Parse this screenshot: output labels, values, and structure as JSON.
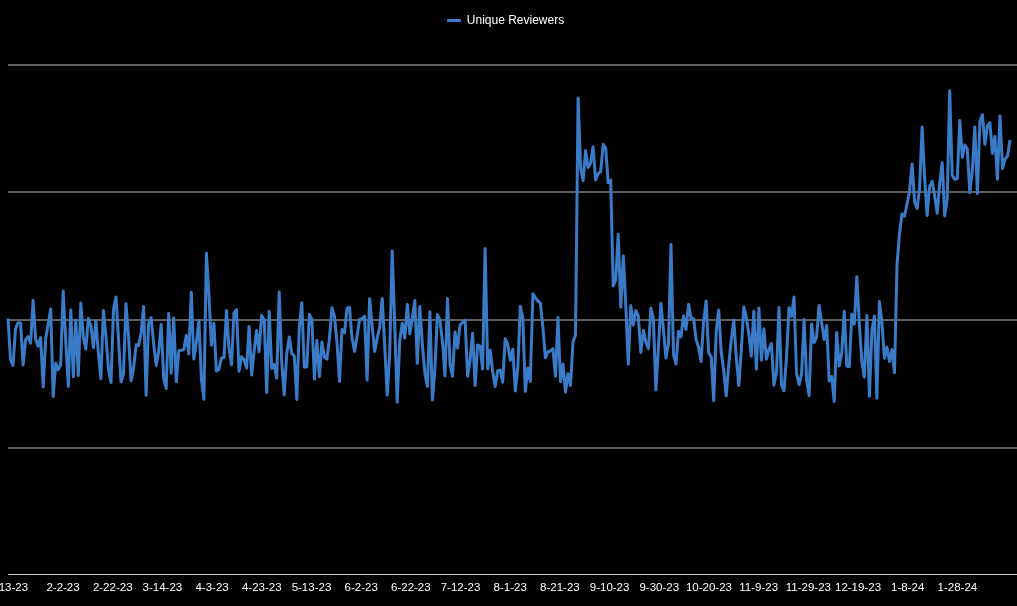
{
  "legend": {
    "label": "Unique Reviewers"
  },
  "x_axis": {
    "labels": [
      "13-23",
      "2-2-23",
      "2-22-23",
      "3-14-23",
      "4-3-23",
      "4-23-23",
      "5-13-23",
      "6-2-23",
      "6-22-23",
      "7-12-23",
      "8-1-23",
      "8-21-23",
      "9-10-23",
      "9-30-23",
      "10-20-23",
      "11-9-23",
      "11-29-23",
      "12-19-23",
      "1-8-24",
      "1-28-24"
    ]
  }
}
